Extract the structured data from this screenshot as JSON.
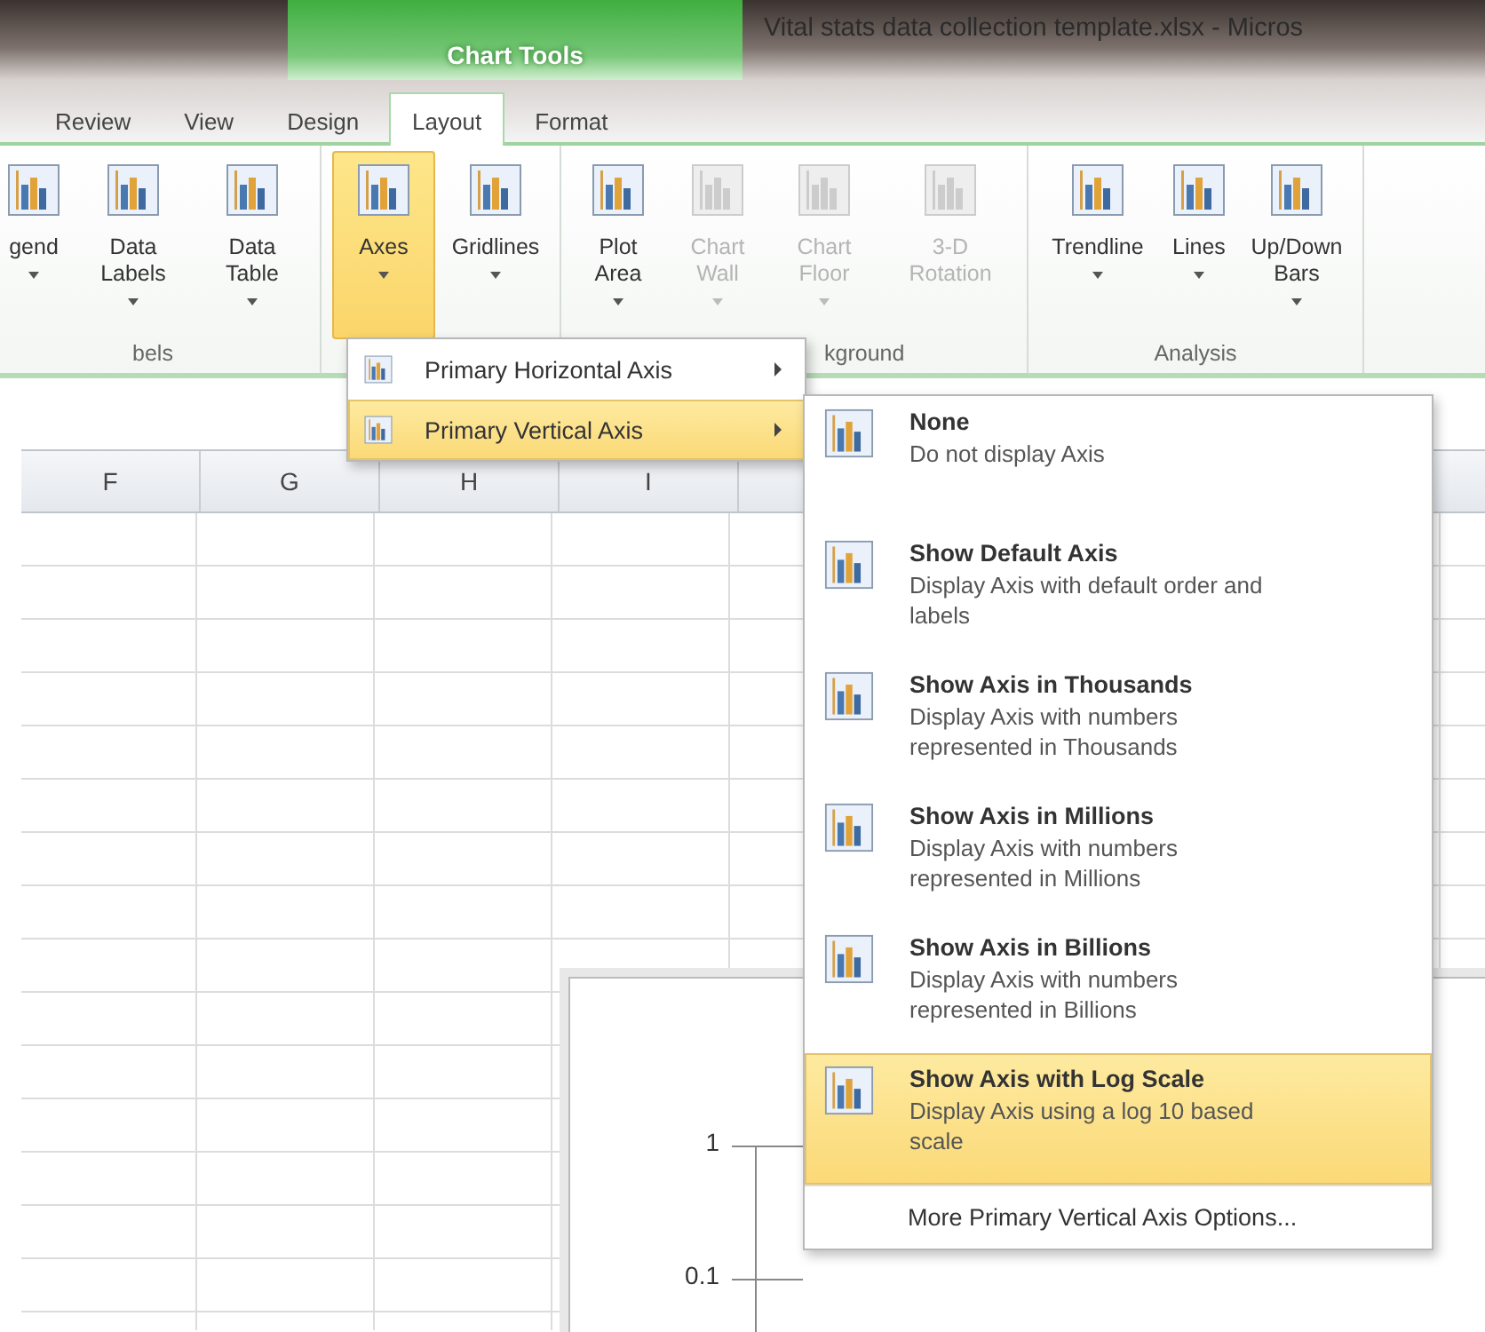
{
  "window": {
    "title": "Vital stats data collection template.xlsx - Micros"
  },
  "context_tab": {
    "label": "Chart Tools"
  },
  "tabs": [
    {
      "label": "Review",
      "selected": false
    },
    {
      "label": "View",
      "selected": false
    },
    {
      "label": "Design",
      "selected": false
    },
    {
      "label": "Layout",
      "selected": true
    },
    {
      "label": "Format",
      "selected": false
    }
  ],
  "ribbon_groups": [
    {
      "label": "bels",
      "buttons": [
        {
          "label": "gend",
          "dropdown": true,
          "selected": false,
          "disabled": false
        },
        {
          "label": "Data Labels",
          "dropdown": true,
          "selected": false,
          "disabled": false
        },
        {
          "label": "Data Table",
          "dropdown": true,
          "selected": false,
          "disabled": false
        }
      ]
    },
    {
      "buttons": [
        {
          "label": "Axes",
          "dropdown": true,
          "selected": true,
          "disabled": false
        },
        {
          "label": "Gridlines",
          "dropdown": true,
          "selected": false,
          "disabled": false
        }
      ]
    },
    {
      "label": "kground",
      "buttons": [
        {
          "label": "Plot Area",
          "dropdown": true,
          "selected": false,
          "disabled": false
        },
        {
          "label": "Chart Wall",
          "dropdown": true,
          "selected": false,
          "disabled": true
        },
        {
          "label": "Chart Floor",
          "dropdown": true,
          "selected": false,
          "disabled": true
        },
        {
          "label": "3-D Rotation",
          "dropdown": false,
          "selected": false,
          "disabled": true
        }
      ]
    },
    {
      "label": "Analysis",
      "buttons": [
        {
          "label": "Trendline",
          "dropdown": true,
          "selected": false,
          "disabled": false
        },
        {
          "label": "Lines",
          "dropdown": true,
          "selected": false,
          "disabled": false
        },
        {
          "label": "Up/Down Bars",
          "dropdown": true,
          "selected": false,
          "disabled": false
        }
      ]
    }
  ],
  "columns": [
    "F",
    "G",
    "H",
    "I"
  ],
  "chart": {
    "axis_labels": [
      "1",
      "0.1"
    ]
  },
  "axes_menu": {
    "items": [
      {
        "label": "Primary Horizontal Axis",
        "selected": false
      },
      {
        "label": "Primary Vertical Axis",
        "selected": true
      }
    ]
  },
  "vertical_axis_menu": {
    "items": [
      {
        "title": "None",
        "description": "Do not display Axis",
        "selected": false
      },
      {
        "title": "Show Default Axis",
        "description": "Display Axis with default order and labels",
        "selected": false
      },
      {
        "title": "Show Axis in Thousands",
        "description": "Display Axis with numbers represented in Thousands",
        "selected": false
      },
      {
        "title": "Show Axis in Millions",
        "description": "Display Axis with numbers represented in Millions",
        "selected": false
      },
      {
        "title": "Show Axis in Billions",
        "description": "Display Axis with numbers represented in Billions",
        "selected": false
      },
      {
        "title": "Show Axis with Log Scale",
        "description": "Display Axis using a log 10 based scale",
        "selected": true
      }
    ],
    "footer": "More Primary Vertical Axis Options..."
  }
}
